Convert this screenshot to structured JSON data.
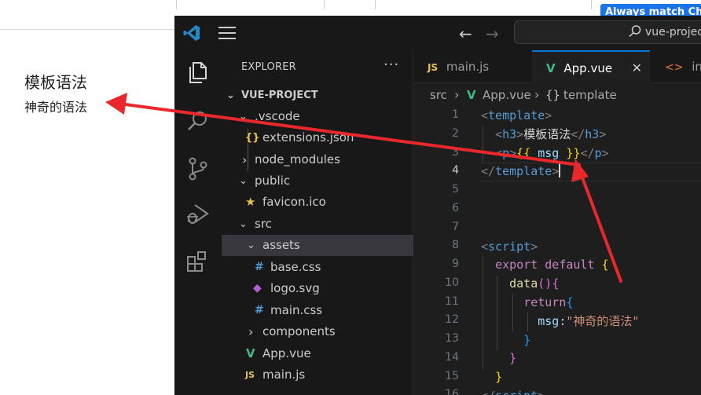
{
  "browser": {
    "banner_text": "Always match Chro",
    "page_heading": "模板语法",
    "page_paragraph": "神奇的语法"
  },
  "vscode": {
    "search_text": "vue-projec",
    "explorer": {
      "title": "EXPLORER",
      "more_label": "···",
      "items": [
        {
          "label": "VUE-PROJECT",
          "chevron": "⌄",
          "icon": "",
          "icon_color": ""
        },
        {
          "label": ".vscode",
          "chevron": "⌄",
          "icon": "",
          "icon_color": ""
        },
        {
          "label": "extensions.json",
          "chevron": "",
          "icon": "{}",
          "icon_color": "#e8c24d"
        },
        {
          "label": "node_modules",
          "chevron": "›",
          "icon": "",
          "icon_color": ""
        },
        {
          "label": "public",
          "chevron": "⌄",
          "icon": "",
          "icon_color": ""
        },
        {
          "label": "favicon.ico",
          "chevron": "",
          "icon": "★",
          "icon_color": "#e8c24d"
        },
        {
          "label": "src",
          "chevron": "⌄",
          "icon": "",
          "icon_color": ""
        },
        {
          "label": "assets",
          "chevron": "⌄",
          "icon": "",
          "icon_color": ""
        },
        {
          "label": "base.css",
          "chevron": "",
          "icon": "#",
          "icon_color": "#4f9bd8"
        },
        {
          "label": "logo.svg",
          "chevron": "",
          "icon": "◆",
          "icon_color": "#b05fd4"
        },
        {
          "label": "main.css",
          "chevron": "",
          "icon": "#",
          "icon_color": "#4f9bd8"
        },
        {
          "label": "components",
          "chevron": "›",
          "icon": "",
          "icon_color": ""
        },
        {
          "label": "App.vue",
          "chevron": "",
          "icon": "V",
          "icon_color": "#41b883"
        },
        {
          "label": "main.js",
          "chevron": "",
          "icon": "JS",
          "icon_color": "#e8c24d"
        }
      ]
    },
    "tabs": [
      {
        "label": "main.js",
        "icon": "JS"
      },
      {
        "label": "App.vue",
        "icon": "V",
        "close": "✕"
      },
      {
        "label": "inde",
        "icon": "<>"
      }
    ],
    "breadcrumb": {
      "folder": "src",
      "file": "App.vue",
      "symbol_icon": "{}",
      "symbol": "template",
      "separator": "›"
    },
    "line_numbers": [
      "1",
      "2",
      "3",
      "4",
      "5",
      "6",
      "7",
      "8",
      "9",
      "10",
      "11",
      "12",
      "13",
      "14",
      "15",
      "16"
    ],
    "code": {
      "l1_open": "<",
      "l1_tag": "template",
      "l1_close": ">",
      "l2_open": "<",
      "l2_tag": "h3",
      "l2_close": ">",
      "l2_text": "模板语法",
      "l2_end_open": "</",
      "l2_end_tag": "h3",
      "l2_end_close": ">",
      "l3_open": "<",
      "l3_tag": "p",
      "l3_close": ">",
      "l3_mustache_open": "{{",
      "l3_var": " msg ",
      "l3_mustache_close": "}}",
      "l3_end_open": "</",
      "l3_end_tag": "p",
      "l3_end_close": ">",
      "l4_open": "</",
      "l4_tag": "template",
      "l4_close": ">",
      "l7_open": "<",
      "l7_tag": "script",
      "l7_close": ">",
      "l8_export": "export",
      "l8_default": " default ",
      "l8_brace": "{",
      "l9_fn": "data",
      "l9_parens": "()",
      "l9_brace": "{",
      "l10_return": "return",
      "l10_brace": "{",
      "l11_key": "msg",
      "l11_colon": ":",
      "l11_value": "\"神奇的语法\"",
      "l12_brace": "}",
      "l13_brace": "}",
      "l14_brace": "}",
      "l15_open": "</",
      "l15_tag": "script",
      "l15_close": ">"
    }
  },
  "colors": {
    "arrow": "#e8282b",
    "accent": "#0078d4",
    "vue_green": "#41b883"
  }
}
